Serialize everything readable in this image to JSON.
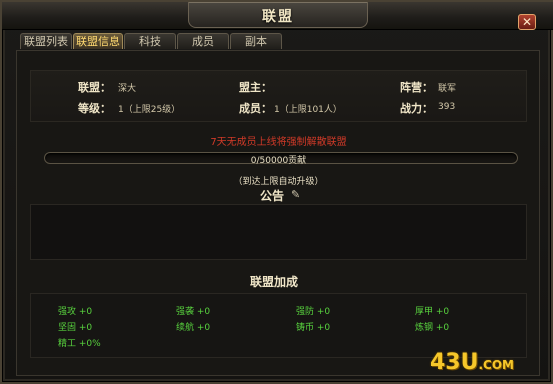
{
  "window": {
    "title": "联盟",
    "close_label": "✕"
  },
  "tabs": [
    {
      "label": "联盟列表"
    },
    {
      "label": "联盟信息"
    },
    {
      "label": "科技"
    },
    {
      "label": "成员"
    },
    {
      "label": "副本"
    }
  ],
  "info": {
    "alliance_label": "联盟：",
    "alliance_value": "深大",
    "leader_label": "盟主：",
    "leader_value": "",
    "camp_label": "阵营：",
    "camp_value": "联军",
    "level_label": "等级：",
    "level_value": "1（上限25级）",
    "members_label": "成员：",
    "members_value": "1（上限101人）",
    "power_label": "战力：",
    "power_value": "393"
  },
  "warning": "7天无成员上线将强制解散联盟",
  "contribution": {
    "text": "0/50000贡献",
    "current": 0,
    "max": 50000
  },
  "auto_upgrade": "（到达上限自动升级）",
  "notice": {
    "title": "公告",
    "edit_icon": "pencil-icon"
  },
  "bonus": {
    "title": "联盟加成",
    "items": [
      "强攻 +0",
      "强袭 +0",
      "强防 +0",
      "厚甲 +0",
      "坚固 +0",
      "续航 +0",
      "铸币 +0",
      "炼钢 +0",
      "精工 +0%"
    ]
  },
  "watermark": {
    "main": "43U",
    "suffix": ".COM"
  },
  "colors": {
    "warning": "#d23a28",
    "bonus": "#58d23e",
    "active_tab": "#ffd970"
  }
}
